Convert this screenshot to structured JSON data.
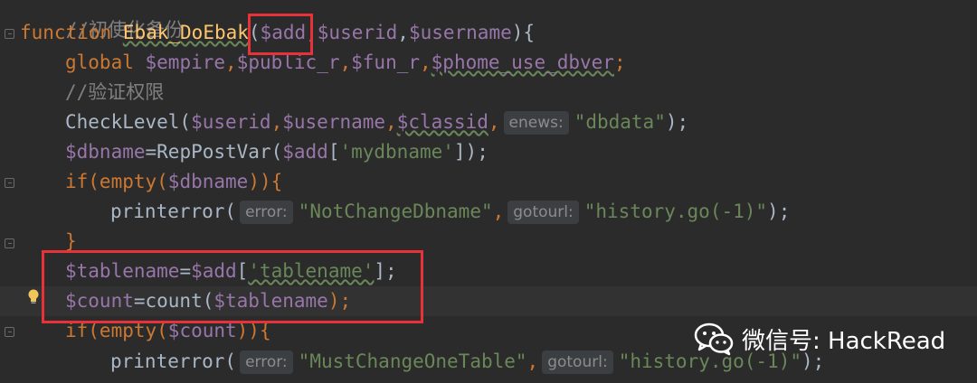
{
  "lines": {
    "l0": {
      "comment": "//初使化备份"
    },
    "l1": {
      "kw": "function",
      "fn": "Ebak_DoEbak",
      "open": "(",
      "p1": "$add",
      "comma1": ",",
      "p2": "$userid",
      "comma2": ",",
      "p3": "$username",
      "close": "){"
    },
    "l2": {
      "kw": "global",
      "v1": "$empire",
      "c1": ",",
      "v2": "$public_r",
      "c2": ",",
      "v3": "$fun_r",
      "c3": ",",
      "v4": "$phome_use_dbver",
      "end": ";"
    },
    "l3": {
      "comment": "//验证权限"
    },
    "l4": {
      "fn": "CheckLevel(",
      "v1": "$userid",
      "c1": ",",
      "v2": "$username",
      "c2": ",",
      "v3": "$classid",
      "c3": ",",
      "hint": "enews:",
      "s": "\"dbdata\"",
      "end": ");"
    },
    "l5": {
      "v1": "$dbname",
      "eq": "=RepPostVar(",
      "v2": "$add",
      "br": "[",
      "s": "'mydbname'",
      "end": "]);"
    },
    "l6": {
      "kw": "if(empty(",
      "v1": "$dbname",
      "end": ")){"
    },
    "l7": {
      "fn": "printerror(",
      "hint1": "error:",
      "s1": "\"NotChangeDbname\"",
      "c1": ",",
      "hint2": "gotourl:",
      "s2": "\"history.go(-1)\"",
      "end": ");"
    },
    "l8": {
      "brace": "}"
    },
    "l9": {
      "v1": "$tablename",
      "eq": "=",
      "v2": "$add",
      "br": "[",
      "s": "'tablename'",
      "end": "];"
    },
    "l10": {
      "v1": "$count",
      "eq": "=count(",
      "v2": "$tablename",
      "end": ");"
    },
    "l11": {
      "kw": "if(empty(",
      "v1": "$count",
      "end": ")){"
    },
    "l12": {
      "fn": "printerror(",
      "hint1": "error:",
      "s1": "\"MustChangeOneTable\"",
      "c1": ",",
      "hint2": "gotourl:",
      "s2": "\"history.go(-1)\"",
      "end": ");"
    }
  },
  "watermark": {
    "text": "微信号: HackRead"
  },
  "icons": {
    "wechat": "wechat-icon",
    "bulb": "lightbulb-icon",
    "fold": "fold-marker-icon"
  },
  "colors": {
    "highlight_box": "#e8323a",
    "background": "#2b2b2b"
  }
}
